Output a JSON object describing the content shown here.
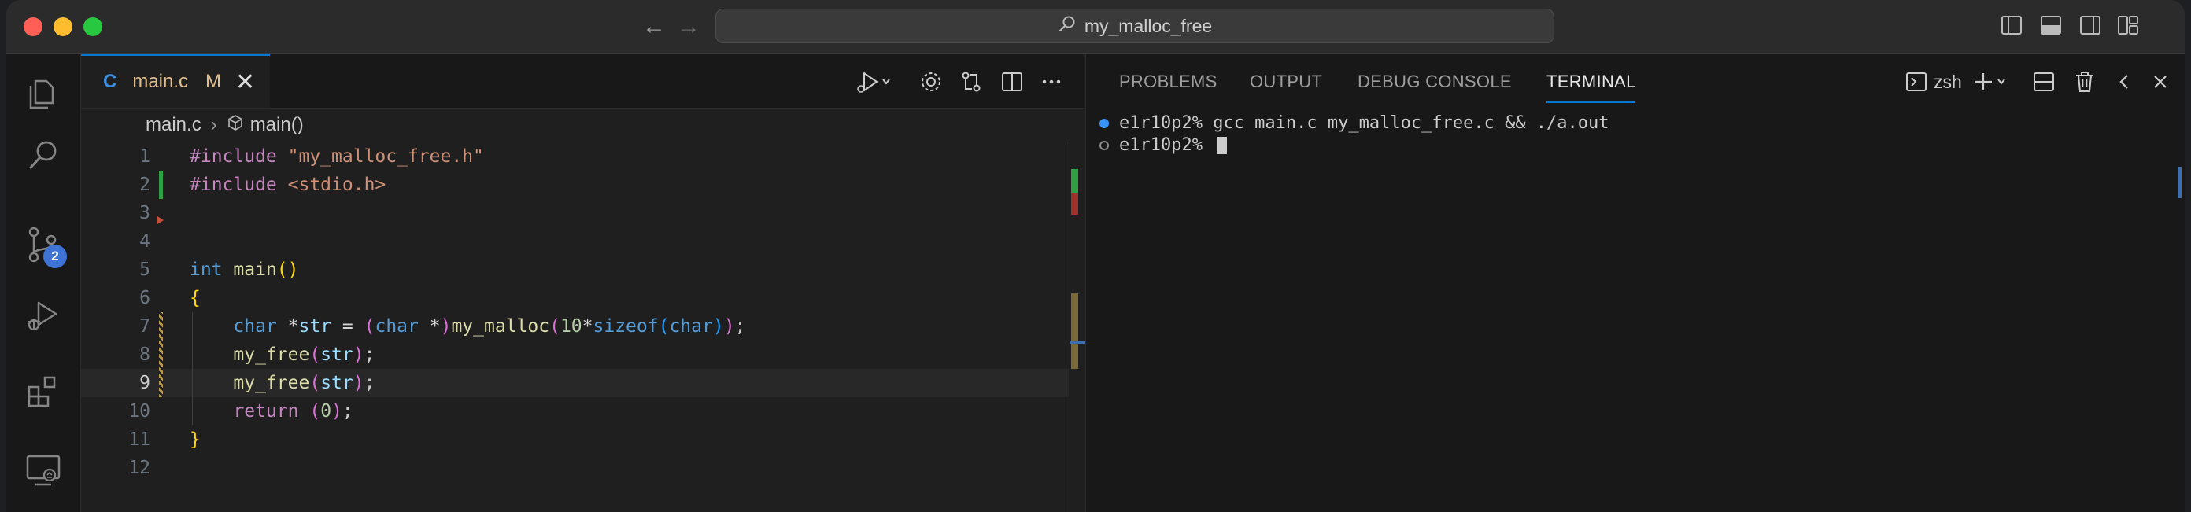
{
  "window": {
    "search_label": "my_malloc_free"
  },
  "activity_bar": {
    "items": [
      "explorer",
      "search",
      "source-control",
      "run-and-debug",
      "extensions",
      "remote-explorer"
    ],
    "source_control_badge": "2"
  },
  "editor": {
    "tab": {
      "lang_icon": "C",
      "filename": "main.c",
      "status": "M"
    },
    "breadcrumbs": {
      "file": "main.c",
      "symbol": "main()"
    },
    "current_line": 9,
    "lines": [
      {
        "n": "1"
      },
      {
        "n": "2"
      },
      {
        "n": "3"
      },
      {
        "n": "4"
      },
      {
        "n": "5"
      },
      {
        "n": "6"
      },
      {
        "n": "7"
      },
      {
        "n": "8"
      },
      {
        "n": "9"
      },
      {
        "n": "10"
      },
      {
        "n": "11"
      },
      {
        "n": "12"
      }
    ]
  },
  "panel": {
    "tabs": [
      "PROBLEMS",
      "OUTPUT",
      "DEBUG CONSOLE",
      "TERMINAL"
    ],
    "active_tab": "TERMINAL",
    "shell_name": "zsh",
    "terminal_lines": [
      "e1r10p2% gcc main.c my_malloc_free.c && ./a.out",
      "e1r10p2% "
    ]
  },
  "colors": {
    "accent": "#0078d4",
    "modified": "#e2c08d",
    "added": "#2ea043",
    "deleted": "#c74e39"
  }
}
